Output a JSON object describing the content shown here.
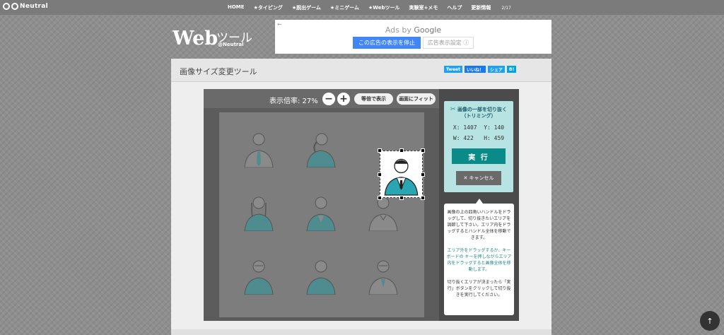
{
  "nav": {
    "brand": "Neutral",
    "links": [
      "HOME",
      "★タイピング",
      "★脱出ゲーム",
      "★ミニゲーム",
      "★Webツール",
      "実験室+メモ",
      "ヘルプ",
      "更新情報"
    ],
    "update_badge": "2/17"
  },
  "logo": {
    "main": "Web",
    "tool": "ツール",
    "sub": "@Neutral"
  },
  "ad": {
    "ads_by": "Ads by",
    "google": "Google",
    "stop_button": "この広告の表示を停止",
    "settings_button": "広告表示設定 ⓘ"
  },
  "page": {
    "title": "画像サイズ変更ツール",
    "share": {
      "tweet": "Tweet",
      "like": "いいね！",
      "share": "シェア",
      "hatena": "B!"
    }
  },
  "toolbar": {
    "zoom_label": "表示倍率: 27%",
    "zoom_out": "−",
    "zoom_in": "+",
    "actual_size": "等倍で表示",
    "fit_screen": "画面にフィット"
  },
  "trim": {
    "title_line1": "画像の一部を切り抜く",
    "title_line2": "（トリミング）",
    "coord_line1": "X: 1407  Y: 140",
    "coord_line2": "W: 422   H: 459",
    "execute": "実 行",
    "cancel": "✕ キャンセル"
  },
  "help": {
    "p1": "画像の上の四角いハンドルをドラッグして、切り抜きたいエリアを調節して下さい。エリア内をドラッグするとハンドル全体を移動できます。",
    "p2": "エリア外をドラッグするか、キーボードの キーを押しながらエリア内をドラッグすると画像全体を移動します。",
    "p3": "切り抜くエリアが決まったら「実行」ボタンをクリックして切り抜きを実行してください。"
  },
  "colors": {
    "teal_button": "#0a8a88",
    "panel_teal": "#b7e3e2",
    "ad_blue": "#4285f4",
    "icon_teal": "#2aa6b3"
  },
  "scroll_top": "↑"
}
